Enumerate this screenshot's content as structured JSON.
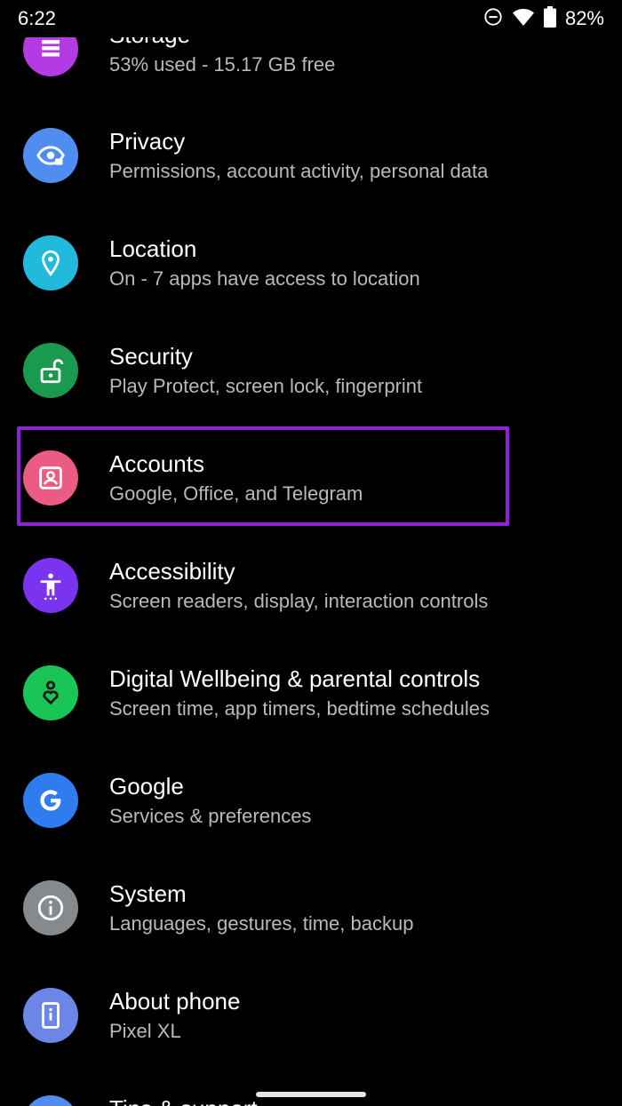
{
  "status_bar": {
    "time": "6:22",
    "battery_percent": "82%",
    "icons": [
      "do-not-disturb-icon",
      "wifi-icon",
      "battery-icon"
    ]
  },
  "settings_items": [
    {
      "title": "Storage",
      "subtitle": "53% used - 15.17 GB free",
      "icon": "storage-icon",
      "color": "#b43be3"
    },
    {
      "title": "Privacy",
      "subtitle": "Permissions, account activity, personal data",
      "icon": "privacy-eye-icon",
      "color": "#4f8ef0"
    },
    {
      "title": "Location",
      "subtitle": "On - 7 apps have access to location",
      "icon": "location-pin-icon",
      "color": "#21b9dc"
    },
    {
      "title": "Security",
      "subtitle": "Play Protect, screen lock, fingerprint",
      "icon": "unlock-icon",
      "color": "#1a9a4f"
    },
    {
      "title": "Accounts",
      "subtitle": "Google, Office, and Telegram",
      "icon": "account-box-icon",
      "color": "#ec5b84"
    },
    {
      "title": "Accessibility",
      "subtitle": "Screen readers, display, interaction controls",
      "icon": "accessibility-icon",
      "color": "#7a34f0"
    },
    {
      "title": "Digital Wellbeing & parental controls",
      "subtitle": "Screen time, app timers, bedtime schedules",
      "icon": "wellbeing-heart-icon",
      "color": "#19c655"
    },
    {
      "title": "Google",
      "subtitle": "Services & preferences",
      "icon": "google-g-icon",
      "color": "#2f7bf0"
    },
    {
      "title": "System",
      "subtitle": "Languages, gestures, time, backup",
      "icon": "info-icon",
      "color": "#878a8d"
    },
    {
      "title": "About phone",
      "subtitle": "Pixel XL",
      "icon": "phone-info-icon",
      "color": "#6b86e6"
    },
    {
      "title": "Tips & support",
      "subtitle": "",
      "icon": "help-icon",
      "color": "#4f8ef0"
    }
  ],
  "highlight_color": "#8e22d6"
}
